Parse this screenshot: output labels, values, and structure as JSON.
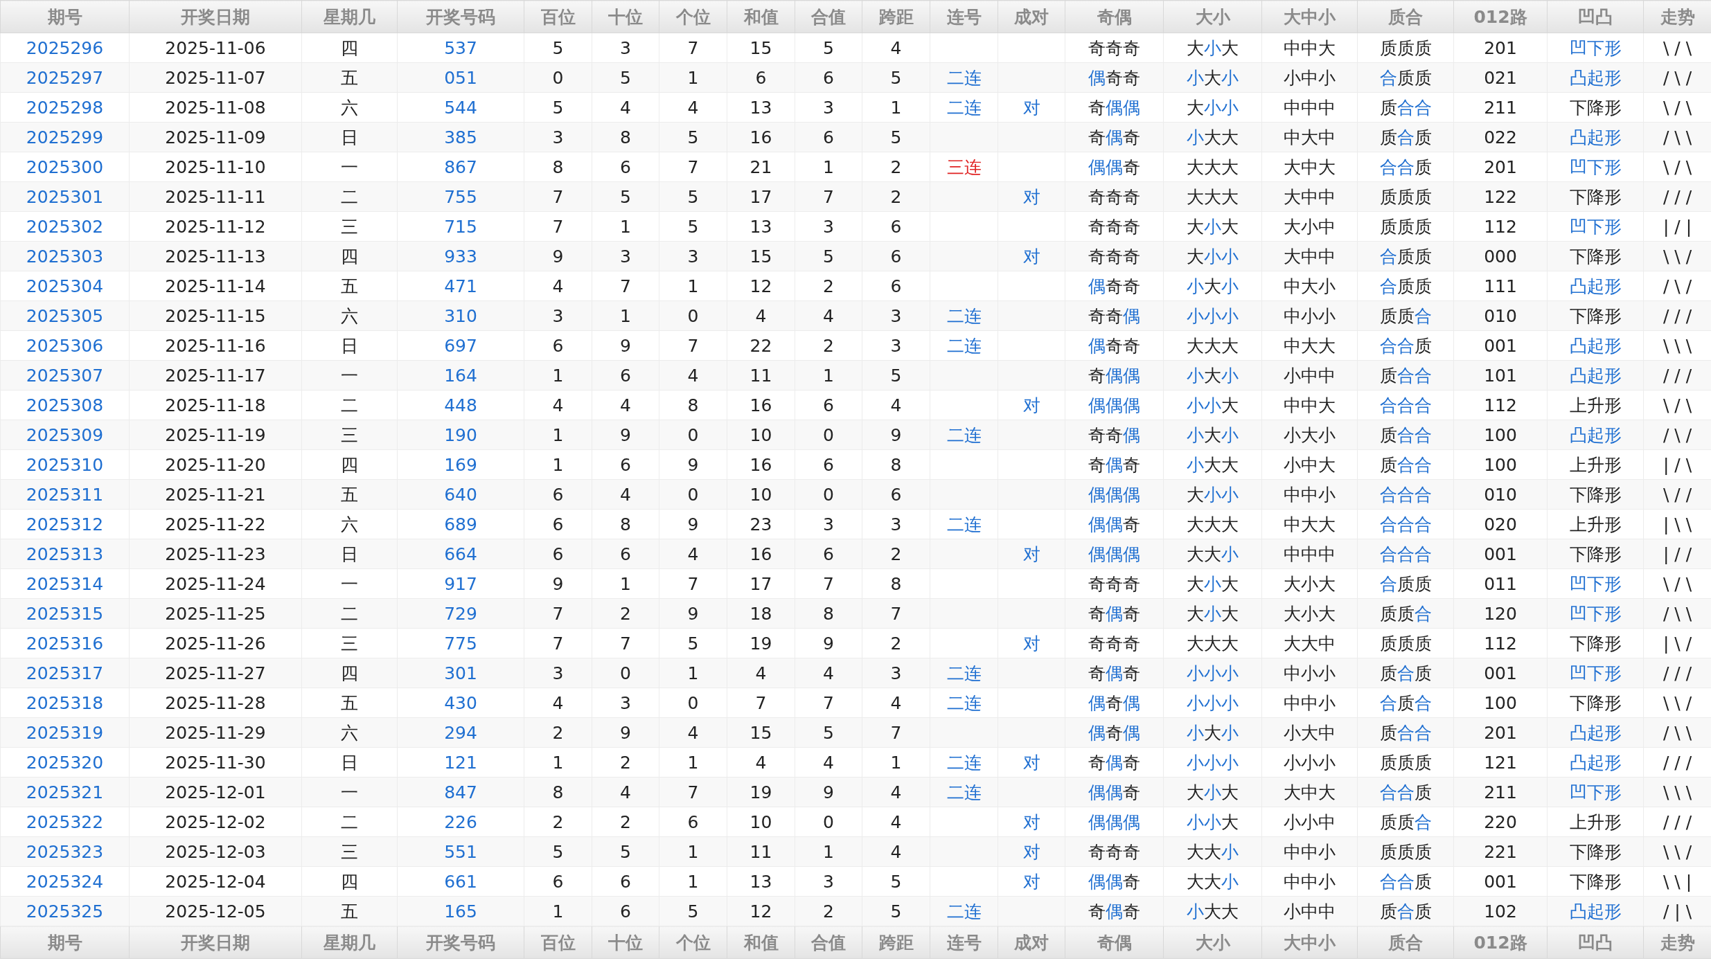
{
  "columns": [
    "期号",
    "开奖日期",
    "星期几",
    "开奖号码",
    "百位",
    "十位",
    "个位",
    "和值",
    "合值",
    "跨距",
    "连号",
    "成对",
    "奇偶",
    "大小",
    "大中小",
    "质合",
    "012路",
    "凹凸",
    "走势"
  ],
  "rows": [
    {
      "period": "2025296",
      "date": "2025-11-06",
      "weekday": "四",
      "number": "537",
      "hundreds": "5",
      "tens": "3",
      "units": "7",
      "sum": "15",
      "sum_tail": "5",
      "span": "4",
      "parity": {
        "chars": [
          "奇",
          "奇",
          "奇"
        ],
        "highlighted": [
          false,
          false,
          false
        ]
      },
      "size": {
        "chars": [
          "大",
          "小",
          "大"
        ],
        "highlighted": [
          false,
          true,
          false
        ]
      },
      "big_mid_small": "中中大",
      "prime": {
        "chars": [
          "质",
          "质",
          "质"
        ],
        "highlighted": [
          false,
          false,
          false
        ]
      },
      "route": "201",
      "shape": {
        "text": "凹下形",
        "highlighted": true
      },
      "trend": "\\ / \\"
    },
    {
      "period": "2025297",
      "date": "2025-11-07",
      "weekday": "五",
      "number": "051",
      "hundreds": "0",
      "tens": "5",
      "units": "1",
      "sum": "6",
      "sum_tail": "6",
      "span": "5",
      "consecutive": {
        "text": "二连",
        "color": "#1f6fd1"
      },
      "parity": {
        "chars": [
          "偶",
          "奇",
          "奇"
        ],
        "highlighted": [
          true,
          false,
          false
        ]
      },
      "size": {
        "chars": [
          "小",
          "大",
          "小"
        ],
        "highlighted": [
          true,
          false,
          true
        ]
      },
      "big_mid_small": "小中小",
      "prime": {
        "chars": [
          "合",
          "质",
          "质"
        ],
        "highlighted": [
          true,
          false,
          false
        ]
      },
      "route": "021",
      "shape": {
        "text": "凸起形",
        "highlighted": true
      },
      "trend": "/ \\ /"
    },
    {
      "period": "2025298",
      "date": "2025-11-08",
      "weekday": "六",
      "number": "544",
      "hundreds": "5",
      "tens": "4",
      "units": "4",
      "sum": "13",
      "sum_tail": "3",
      "span": "1",
      "consecutive": {
        "text": "二连",
        "color": "#1f6fd1"
      },
      "pair": "对",
      "parity": {
        "chars": [
          "奇",
          "偶",
          "偶"
        ],
        "highlighted": [
          false,
          true,
          true
        ]
      },
      "size": {
        "chars": [
          "大",
          "小",
          "小"
        ],
        "highlighted": [
          false,
          true,
          true
        ]
      },
      "big_mid_small": "中中中",
      "prime": {
        "chars": [
          "质",
          "合",
          "合"
        ],
        "highlighted": [
          false,
          true,
          true
        ]
      },
      "route": "211",
      "shape": {
        "text": "下降形",
        "highlighted": false
      },
      "trend": "\\ / \\"
    },
    {
      "period": "2025299",
      "date": "2025-11-09",
      "weekday": "日",
      "number": "385",
      "hundreds": "3",
      "tens": "8",
      "units": "5",
      "sum": "16",
      "sum_tail": "6",
      "span": "5",
      "parity": {
        "chars": [
          "奇",
          "偶",
          "奇"
        ],
        "highlighted": [
          false,
          true,
          false
        ]
      },
      "size": {
        "chars": [
          "小",
          "大",
          "大"
        ],
        "highlighted": [
          true,
          false,
          false
        ]
      },
      "big_mid_small": "中大中",
      "prime": {
        "chars": [
          "质",
          "合",
          "质"
        ],
        "highlighted": [
          false,
          true,
          false
        ]
      },
      "route": "022",
      "shape": {
        "text": "凸起形",
        "highlighted": true
      },
      "trend": "/ \\ \\"
    },
    {
      "period": "2025300",
      "date": "2025-11-10",
      "weekday": "一",
      "number": "867",
      "hundreds": "8",
      "tens": "6",
      "units": "7",
      "sum": "21",
      "sum_tail": "1",
      "span": "2",
      "consecutive": {
        "text": "三连",
        "color": "#e02424"
      },
      "parity": {
        "chars": [
          "偶",
          "偶",
          "奇"
        ],
        "highlighted": [
          true,
          true,
          false
        ]
      },
      "size": {
        "chars": [
          "大",
          "大",
          "大"
        ],
        "highlighted": [
          false,
          false,
          false
        ]
      },
      "big_mid_small": "大中大",
      "prime": {
        "chars": [
          "合",
          "合",
          "质"
        ],
        "highlighted": [
          true,
          true,
          false
        ]
      },
      "route": "201",
      "shape": {
        "text": "凹下形",
        "highlighted": true
      },
      "trend": "\\ / \\"
    },
    {
      "period": "2025301",
      "date": "2025-11-11",
      "weekday": "二",
      "number": "755",
      "hundreds": "7",
      "tens": "5",
      "units": "5",
      "sum": "17",
      "sum_tail": "7",
      "span": "2",
      "pair": "对",
      "parity": {
        "chars": [
          "奇",
          "奇",
          "奇"
        ],
        "highlighted": [
          false,
          false,
          false
        ]
      },
      "size": {
        "chars": [
          "大",
          "大",
          "大"
        ],
        "highlighted": [
          false,
          false,
          false
        ]
      },
      "big_mid_small": "大中中",
      "prime": {
        "chars": [
          "质",
          "质",
          "质"
        ],
        "highlighted": [
          false,
          false,
          false
        ]
      },
      "route": "122",
      "shape": {
        "text": "下降形",
        "highlighted": false
      },
      "trend": "/ / /"
    },
    {
      "period": "2025302",
      "date": "2025-11-12",
      "weekday": "三",
      "number": "715",
      "hundreds": "7",
      "tens": "1",
      "units": "5",
      "sum": "13",
      "sum_tail": "3",
      "span": "6",
      "parity": {
        "chars": [
          "奇",
          "奇",
          "奇"
        ],
        "highlighted": [
          false,
          false,
          false
        ]
      },
      "size": {
        "chars": [
          "大",
          "小",
          "大"
        ],
        "highlighted": [
          false,
          true,
          false
        ]
      },
      "big_mid_small": "大小中",
      "prime": {
        "chars": [
          "质",
          "质",
          "质"
        ],
        "highlighted": [
          false,
          false,
          false
        ]
      },
      "route": "112",
      "shape": {
        "text": "凹下形",
        "highlighted": true
      },
      "trend": "| / |"
    },
    {
      "period": "2025303",
      "date": "2025-11-13",
      "weekday": "四",
      "number": "933",
      "hundreds": "9",
      "tens": "3",
      "units": "3",
      "sum": "15",
      "sum_tail": "5",
      "span": "6",
      "pair": "对",
      "parity": {
        "chars": [
          "奇",
          "奇",
          "奇"
        ],
        "highlighted": [
          false,
          false,
          false
        ]
      },
      "size": {
        "chars": [
          "大",
          "小",
          "小"
        ],
        "highlighted": [
          false,
          true,
          true
        ]
      },
      "big_mid_small": "大中中",
      "prime": {
        "chars": [
          "合",
          "质",
          "质"
        ],
        "highlighted": [
          true,
          false,
          false
        ]
      },
      "route": "000",
      "shape": {
        "text": "下降形",
        "highlighted": false
      },
      "trend": "\\ \\ /"
    },
    {
      "period": "2025304",
      "date": "2025-11-14",
      "weekday": "五",
      "number": "471",
      "hundreds": "4",
      "tens": "7",
      "units": "1",
      "sum": "12",
      "sum_tail": "2",
      "span": "6",
      "parity": {
        "chars": [
          "偶",
          "奇",
          "奇"
        ],
        "highlighted": [
          true,
          false,
          false
        ]
      },
      "size": {
        "chars": [
          "小",
          "大",
          "小"
        ],
        "highlighted": [
          true,
          false,
          true
        ]
      },
      "big_mid_small": "中大小",
      "prime": {
        "chars": [
          "合",
          "质",
          "质"
        ],
        "highlighted": [
          true,
          false,
          false
        ]
      },
      "route": "111",
      "shape": {
        "text": "凸起形",
        "highlighted": true
      },
      "trend": "/ \\ /"
    },
    {
      "period": "2025305",
      "date": "2025-11-15",
      "weekday": "六",
      "number": "310",
      "hundreds": "3",
      "tens": "1",
      "units": "0",
      "sum": "4",
      "sum_tail": "4",
      "span": "3",
      "consecutive": {
        "text": "二连",
        "color": "#1f6fd1"
      },
      "parity": {
        "chars": [
          "奇",
          "奇",
          "偶"
        ],
        "highlighted": [
          false,
          false,
          true
        ]
      },
      "size": {
        "chars": [
          "小",
          "小",
          "小"
        ],
        "highlighted": [
          true,
          true,
          true
        ]
      },
      "big_mid_small": "中小小",
      "prime": {
        "chars": [
          "质",
          "质",
          "合"
        ],
        "highlighted": [
          false,
          false,
          true
        ]
      },
      "route": "010",
      "shape": {
        "text": "下降形",
        "highlighted": false
      },
      "trend": "/ / /"
    },
    {
      "period": "2025306",
      "date": "2025-11-16",
      "weekday": "日",
      "number": "697",
      "hundreds": "6",
      "tens": "9",
      "units": "7",
      "sum": "22",
      "sum_tail": "2",
      "span": "3",
      "consecutive": {
        "text": "二连",
        "color": "#1f6fd1"
      },
      "parity": {
        "chars": [
          "偶",
          "奇",
          "奇"
        ],
        "highlighted": [
          true,
          false,
          false
        ]
      },
      "size": {
        "chars": [
          "大",
          "大",
          "大"
        ],
        "highlighted": [
          false,
          false,
          false
        ]
      },
      "big_mid_small": "中大大",
      "prime": {
        "chars": [
          "合",
          "合",
          "质"
        ],
        "highlighted": [
          true,
          true,
          false
        ]
      },
      "route": "001",
      "shape": {
        "text": "凸起形",
        "highlighted": true
      },
      "trend": "\\ \\ \\"
    },
    {
      "period": "2025307",
      "date": "2025-11-17",
      "weekday": "一",
      "number": "164",
      "hundreds": "1",
      "tens": "6",
      "units": "4",
      "sum": "11",
      "sum_tail": "1",
      "span": "5",
      "parity": {
        "chars": [
          "奇",
          "偶",
          "偶"
        ],
        "highlighted": [
          false,
          true,
          true
        ]
      },
      "size": {
        "chars": [
          "小",
          "大",
          "小"
        ],
        "highlighted": [
          true,
          false,
          true
        ]
      },
      "big_mid_small": "小中中",
      "prime": {
        "chars": [
          "质",
          "合",
          "合"
        ],
        "highlighted": [
          false,
          true,
          true
        ]
      },
      "route": "101",
      "shape": {
        "text": "凸起形",
        "highlighted": true
      },
      "trend": "/ / /"
    },
    {
      "period": "2025308",
      "date": "2025-11-18",
      "weekday": "二",
      "number": "448",
      "hundreds": "4",
      "tens": "4",
      "units": "8",
      "sum": "16",
      "sum_tail": "6",
      "span": "4",
      "pair": "对",
      "parity": {
        "chars": [
          "偶",
          "偶",
          "偶"
        ],
        "highlighted": [
          true,
          true,
          true
        ]
      },
      "size": {
        "chars": [
          "小",
          "小",
          "大"
        ],
        "highlighted": [
          true,
          true,
          false
        ]
      },
      "big_mid_small": "中中大",
      "prime": {
        "chars": [
          "合",
          "合",
          "合"
        ],
        "highlighted": [
          true,
          true,
          true
        ]
      },
      "route": "112",
      "shape": {
        "text": "上升形",
        "highlighted": false
      },
      "trend": "\\ / \\"
    },
    {
      "period": "2025309",
      "date": "2025-11-19",
      "weekday": "三",
      "number": "190",
      "hundreds": "1",
      "tens": "9",
      "units": "0",
      "sum": "10",
      "sum_tail": "0",
      "span": "9",
      "consecutive": {
        "text": "二连",
        "color": "#1f6fd1"
      },
      "parity": {
        "chars": [
          "奇",
          "奇",
          "偶"
        ],
        "highlighted": [
          false,
          false,
          true
        ]
      },
      "size": {
        "chars": [
          "小",
          "大",
          "小"
        ],
        "highlighted": [
          true,
          false,
          true
        ]
      },
      "big_mid_small": "小大小",
      "prime": {
        "chars": [
          "质",
          "合",
          "合"
        ],
        "highlighted": [
          false,
          true,
          true
        ]
      },
      "route": "100",
      "shape": {
        "text": "凸起形",
        "highlighted": true
      },
      "trend": "/ \\ /"
    },
    {
      "period": "2025310",
      "date": "2025-11-20",
      "weekday": "四",
      "number": "169",
      "hundreds": "1",
      "tens": "6",
      "units": "9",
      "sum": "16",
      "sum_tail": "6",
      "span": "8",
      "parity": {
        "chars": [
          "奇",
          "偶",
          "奇"
        ],
        "highlighted": [
          false,
          true,
          false
        ]
      },
      "size": {
        "chars": [
          "小",
          "大",
          "大"
        ],
        "highlighted": [
          true,
          false,
          false
        ]
      },
      "big_mid_small": "小中大",
      "prime": {
        "chars": [
          "质",
          "合",
          "合"
        ],
        "highlighted": [
          false,
          true,
          true
        ]
      },
      "route": "100",
      "shape": {
        "text": "上升形",
        "highlighted": false
      },
      "trend": "| / \\"
    },
    {
      "period": "2025311",
      "date": "2025-11-21",
      "weekday": "五",
      "number": "640",
      "hundreds": "6",
      "tens": "4",
      "units": "0",
      "sum": "10",
      "sum_tail": "0",
      "span": "6",
      "parity": {
        "chars": [
          "偶",
          "偶",
          "偶"
        ],
        "highlighted": [
          true,
          true,
          true
        ]
      },
      "size": {
        "chars": [
          "大",
          "小",
          "小"
        ],
        "highlighted": [
          false,
          true,
          true
        ]
      },
      "big_mid_small": "中中小",
      "prime": {
        "chars": [
          "合",
          "合",
          "合"
        ],
        "highlighted": [
          true,
          true,
          true
        ]
      },
      "route": "010",
      "shape": {
        "text": "下降形",
        "highlighted": false
      },
      "trend": "\\ / /"
    },
    {
      "period": "2025312",
      "date": "2025-11-22",
      "weekday": "六",
      "number": "689",
      "hundreds": "6",
      "tens": "8",
      "units": "9",
      "sum": "23",
      "sum_tail": "3",
      "span": "3",
      "consecutive": {
        "text": "二连",
        "color": "#1f6fd1"
      },
      "parity": {
        "chars": [
          "偶",
          "偶",
          "奇"
        ],
        "highlighted": [
          true,
          true,
          false
        ]
      },
      "size": {
        "chars": [
          "大",
          "大",
          "大"
        ],
        "highlighted": [
          false,
          false,
          false
        ]
      },
      "big_mid_small": "中大大",
      "prime": {
        "chars": [
          "合",
          "合",
          "合"
        ],
        "highlighted": [
          true,
          true,
          true
        ]
      },
      "route": "020",
      "shape": {
        "text": "上升形",
        "highlighted": false
      },
      "trend": "| \\ \\"
    },
    {
      "period": "2025313",
      "date": "2025-11-23",
      "weekday": "日",
      "number": "664",
      "hundreds": "6",
      "tens": "6",
      "units": "4",
      "sum": "16",
      "sum_tail": "6",
      "span": "2",
      "pair": "对",
      "parity": {
        "chars": [
          "偶",
          "偶",
          "偶"
        ],
        "highlighted": [
          true,
          true,
          true
        ]
      },
      "size": {
        "chars": [
          "大",
          "大",
          "小"
        ],
        "highlighted": [
          false,
          false,
          true
        ]
      },
      "big_mid_small": "中中中",
      "prime": {
        "chars": [
          "合",
          "合",
          "合"
        ],
        "highlighted": [
          true,
          true,
          true
        ]
      },
      "route": "001",
      "shape": {
        "text": "下降形",
        "highlighted": false
      },
      "trend": "| / /"
    },
    {
      "period": "2025314",
      "date": "2025-11-24",
      "weekday": "一",
      "number": "917",
      "hundreds": "9",
      "tens": "1",
      "units": "7",
      "sum": "17",
      "sum_tail": "7",
      "span": "8",
      "parity": {
        "chars": [
          "奇",
          "奇",
          "奇"
        ],
        "highlighted": [
          false,
          false,
          false
        ]
      },
      "size": {
        "chars": [
          "大",
          "小",
          "大"
        ],
        "highlighted": [
          false,
          true,
          false
        ]
      },
      "big_mid_small": "大小大",
      "prime": {
        "chars": [
          "合",
          "质",
          "质"
        ],
        "highlighted": [
          true,
          false,
          false
        ]
      },
      "route": "011",
      "shape": {
        "text": "凹下形",
        "highlighted": true
      },
      "trend": "\\ / \\"
    },
    {
      "period": "2025315",
      "date": "2025-11-25",
      "weekday": "二",
      "number": "729",
      "hundreds": "7",
      "tens": "2",
      "units": "9",
      "sum": "18",
      "sum_tail": "8",
      "span": "7",
      "parity": {
        "chars": [
          "奇",
          "偶",
          "奇"
        ],
        "highlighted": [
          false,
          true,
          false
        ]
      },
      "size": {
        "chars": [
          "大",
          "小",
          "大"
        ],
        "highlighted": [
          false,
          true,
          false
        ]
      },
      "big_mid_small": "大小大",
      "prime": {
        "chars": [
          "质",
          "质",
          "合"
        ],
        "highlighted": [
          false,
          false,
          true
        ]
      },
      "route": "120",
      "shape": {
        "text": "凹下形",
        "highlighted": true
      },
      "trend": "/ \\ \\"
    },
    {
      "period": "2025316",
      "date": "2025-11-26",
      "weekday": "三",
      "number": "775",
      "hundreds": "7",
      "tens": "7",
      "units": "5",
      "sum": "19",
      "sum_tail": "9",
      "span": "2",
      "pair": "对",
      "parity": {
        "chars": [
          "奇",
          "奇",
          "奇"
        ],
        "highlighted": [
          false,
          false,
          false
        ]
      },
      "size": {
        "chars": [
          "大",
          "大",
          "大"
        ],
        "highlighted": [
          false,
          false,
          false
        ]
      },
      "big_mid_small": "大大中",
      "prime": {
        "chars": [
          "质",
          "质",
          "质"
        ],
        "highlighted": [
          false,
          false,
          false
        ]
      },
      "route": "112",
      "shape": {
        "text": "下降形",
        "highlighted": false
      },
      "trend": "| \\ /"
    },
    {
      "period": "2025317",
      "date": "2025-11-27",
      "weekday": "四",
      "number": "301",
      "hundreds": "3",
      "tens": "0",
      "units": "1",
      "sum": "4",
      "sum_tail": "4",
      "span": "3",
      "consecutive": {
        "text": "二连",
        "color": "#1f6fd1"
      },
      "parity": {
        "chars": [
          "奇",
          "偶",
          "奇"
        ],
        "highlighted": [
          false,
          true,
          false
        ]
      },
      "size": {
        "chars": [
          "小",
          "小",
          "小"
        ],
        "highlighted": [
          true,
          true,
          true
        ]
      },
      "big_mid_small": "中小小",
      "prime": {
        "chars": [
          "质",
          "合",
          "质"
        ],
        "highlighted": [
          false,
          true,
          false
        ]
      },
      "route": "001",
      "shape": {
        "text": "凹下形",
        "highlighted": true
      },
      "trend": "/ / /"
    },
    {
      "period": "2025318",
      "date": "2025-11-28",
      "weekday": "五",
      "number": "430",
      "hundreds": "4",
      "tens": "3",
      "units": "0",
      "sum": "7",
      "sum_tail": "7",
      "span": "4",
      "consecutive": {
        "text": "二连",
        "color": "#1f6fd1"
      },
      "parity": {
        "chars": [
          "偶",
          "奇",
          "偶"
        ],
        "highlighted": [
          true,
          false,
          true
        ]
      },
      "size": {
        "chars": [
          "小",
          "小",
          "小"
        ],
        "highlighted": [
          true,
          true,
          true
        ]
      },
      "big_mid_small": "中中小",
      "prime": {
        "chars": [
          "合",
          "质",
          "合"
        ],
        "highlighted": [
          true,
          false,
          true
        ]
      },
      "route": "100",
      "shape": {
        "text": "下降形",
        "highlighted": false
      },
      "trend": "\\ \\ /"
    },
    {
      "period": "2025319",
      "date": "2025-11-29",
      "weekday": "六",
      "number": "294",
      "hundreds": "2",
      "tens": "9",
      "units": "4",
      "sum": "15",
      "sum_tail": "5",
      "span": "7",
      "parity": {
        "chars": [
          "偶",
          "奇",
          "偶"
        ],
        "highlighted": [
          true,
          false,
          true
        ]
      },
      "size": {
        "chars": [
          "小",
          "大",
          "小"
        ],
        "highlighted": [
          true,
          false,
          true
        ]
      },
      "big_mid_small": "小大中",
      "prime": {
        "chars": [
          "质",
          "合",
          "合"
        ],
        "highlighted": [
          false,
          true,
          true
        ]
      },
      "route": "201",
      "shape": {
        "text": "凸起形",
        "highlighted": true
      },
      "trend": "/ \\ \\"
    },
    {
      "period": "2025320",
      "date": "2025-11-30",
      "weekday": "日",
      "number": "121",
      "hundreds": "1",
      "tens": "2",
      "units": "1",
      "sum": "4",
      "sum_tail": "4",
      "span": "1",
      "consecutive": {
        "text": "二连",
        "color": "#1f6fd1"
      },
      "pair": "对",
      "parity": {
        "chars": [
          "奇",
          "偶",
          "奇"
        ],
        "highlighted": [
          false,
          true,
          false
        ]
      },
      "size": {
        "chars": [
          "小",
          "小",
          "小"
        ],
        "highlighted": [
          true,
          true,
          true
        ]
      },
      "big_mid_small": "小小小",
      "prime": {
        "chars": [
          "质",
          "质",
          "质"
        ],
        "highlighted": [
          false,
          false,
          false
        ]
      },
      "route": "121",
      "shape": {
        "text": "凸起形",
        "highlighted": true
      },
      "trend": "/ / /"
    },
    {
      "period": "2025321",
      "date": "2025-12-01",
      "weekday": "一",
      "number": "847",
      "hundreds": "8",
      "tens": "4",
      "units": "7",
      "sum": "19",
      "sum_tail": "9",
      "span": "4",
      "consecutive": {
        "text": "二连",
        "color": "#1f6fd1"
      },
      "parity": {
        "chars": [
          "偶",
          "偶",
          "奇"
        ],
        "highlighted": [
          true,
          true,
          false
        ]
      },
      "size": {
        "chars": [
          "大",
          "小",
          "大"
        ],
        "highlighted": [
          false,
          true,
          false
        ]
      },
      "big_mid_small": "大中大",
      "prime": {
        "chars": [
          "合",
          "合",
          "质"
        ],
        "highlighted": [
          true,
          true,
          false
        ]
      },
      "route": "211",
      "shape": {
        "text": "凹下形",
        "highlighted": true
      },
      "trend": "\\ \\ \\"
    },
    {
      "period": "2025322",
      "date": "2025-12-02",
      "weekday": "二",
      "number": "226",
      "hundreds": "2",
      "tens": "2",
      "units": "6",
      "sum": "10",
      "sum_tail": "0",
      "span": "4",
      "pair": "对",
      "parity": {
        "chars": [
          "偶",
          "偶",
          "偶"
        ],
        "highlighted": [
          true,
          true,
          true
        ]
      },
      "size": {
        "chars": [
          "小",
          "小",
          "大"
        ],
        "highlighted": [
          true,
          true,
          false
        ]
      },
      "big_mid_small": "小小中",
      "prime": {
        "chars": [
          "质",
          "质",
          "合"
        ],
        "highlighted": [
          false,
          false,
          true
        ]
      },
      "route": "220",
      "shape": {
        "text": "上升形",
        "highlighted": false
      },
      "trend": "/ / /"
    },
    {
      "period": "2025323",
      "date": "2025-12-03",
      "weekday": "三",
      "number": "551",
      "hundreds": "5",
      "tens": "5",
      "units": "1",
      "sum": "11",
      "sum_tail": "1",
      "span": "4",
      "pair": "对",
      "parity": {
        "chars": [
          "奇",
          "奇",
          "奇"
        ],
        "highlighted": [
          false,
          false,
          false
        ]
      },
      "size": {
        "chars": [
          "大",
          "大",
          "小"
        ],
        "highlighted": [
          false,
          false,
          true
        ]
      },
      "big_mid_small": "中中小",
      "prime": {
        "chars": [
          "质",
          "质",
          "质"
        ],
        "highlighted": [
          false,
          false,
          false
        ]
      },
      "route": "221",
      "shape": {
        "text": "下降形",
        "highlighted": false
      },
      "trend": "\\ \\ /"
    },
    {
      "period": "2025324",
      "date": "2025-12-04",
      "weekday": "四",
      "number": "661",
      "hundreds": "6",
      "tens": "6",
      "units": "1",
      "sum": "13",
      "sum_tail": "3",
      "span": "5",
      "pair": "对",
      "parity": {
        "chars": [
          "偶",
          "偶",
          "奇"
        ],
        "highlighted": [
          true,
          true,
          false
        ]
      },
      "size": {
        "chars": [
          "大",
          "大",
          "小"
        ],
        "highlighted": [
          false,
          false,
          true
        ]
      },
      "big_mid_small": "中中小",
      "prime": {
        "chars": [
          "合",
          "合",
          "质"
        ],
        "highlighted": [
          true,
          true,
          false
        ]
      },
      "route": "001",
      "shape": {
        "text": "下降形",
        "highlighted": false
      },
      "trend": "\\ \\ |"
    },
    {
      "period": "2025325",
      "date": "2025-12-05",
      "weekday": "五",
      "number": "165",
      "hundreds": "1",
      "tens": "6",
      "units": "5",
      "sum": "12",
      "sum_tail": "2",
      "span": "5",
      "consecutive": {
        "text": "二连",
        "color": "#1f6fd1"
      },
      "parity": {
        "chars": [
          "奇",
          "偶",
          "奇"
        ],
        "highlighted": [
          false,
          true,
          false
        ]
      },
      "size": {
        "chars": [
          "小",
          "大",
          "大"
        ],
        "highlighted": [
          true,
          false,
          false
        ]
      },
      "big_mid_small": "小中中",
      "prime": {
        "chars": [
          "质",
          "合",
          "质"
        ],
        "highlighted": [
          false,
          true,
          false
        ]
      },
      "route": "102",
      "shape": {
        "text": "凸起形",
        "highlighted": true
      },
      "trend": "/ | \\"
    }
  ],
  "footer_columns": [
    "期号",
    "开奖日期",
    "星期几",
    "开奖号码",
    "百位",
    "十位",
    "个位",
    "和值",
    "合值",
    "跨距",
    "连号",
    "成对",
    "奇偶",
    "大小",
    "大中小",
    "质合",
    "012路",
    "凹凸",
    "走势"
  ]
}
